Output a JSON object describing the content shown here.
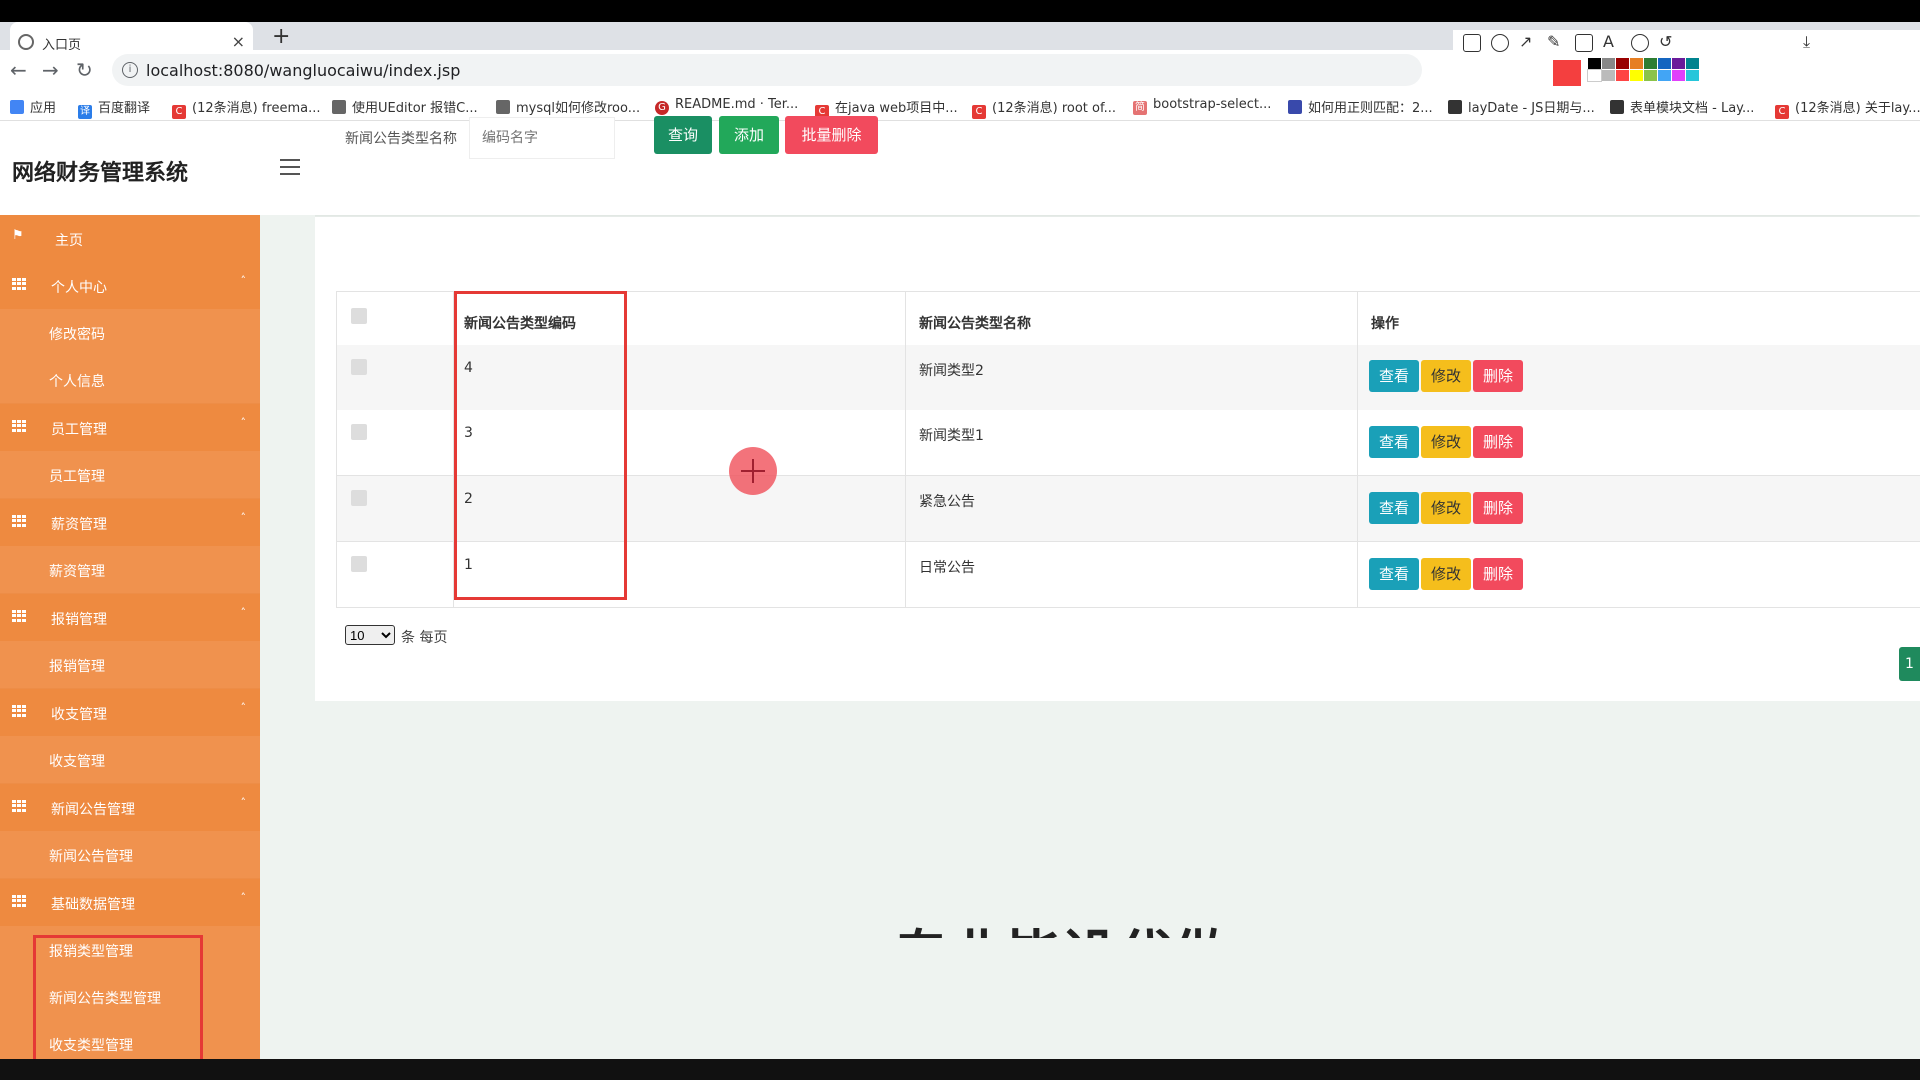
{
  "browser": {
    "tab_title": "入口页",
    "tab_close": "×",
    "new_tab": "+",
    "url": "localhost:8080/wangluocaiwu/index.jsp",
    "bookmarks": [
      "应用",
      "百度翻译",
      "(12条消息) freema...",
      "使用UEditor 报错C...",
      "mysql如何修改roo...",
      "README.md · Ter...",
      "在java web项目中...",
      "(12条消息) root of...",
      "bootstrap-select...",
      "如何用正则匹配：2...",
      "layDate - JS日期与...",
      "表单模块文档 - Lay...",
      "(12条消息) 关于lay..."
    ]
  },
  "app": {
    "brand": "网络财务管理系统",
    "sidebar": [
      {
        "label": "主页",
        "type": "top"
      },
      {
        "label": "个人中心",
        "type": "parent"
      },
      {
        "label": "修改密码",
        "type": "child"
      },
      {
        "label": "个人信息",
        "type": "child"
      },
      {
        "label": "员工管理",
        "type": "parent"
      },
      {
        "label": "员工管理",
        "type": "child"
      },
      {
        "label": "薪资管理",
        "type": "parent"
      },
      {
        "label": "薪资管理",
        "type": "child"
      },
      {
        "label": "报销管理",
        "type": "parent"
      },
      {
        "label": "报销管理",
        "type": "child"
      },
      {
        "label": "收支管理",
        "type": "parent"
      },
      {
        "label": "收支管理",
        "type": "child"
      },
      {
        "label": "新闻公告管理",
        "type": "parent"
      },
      {
        "label": "新闻公告管理",
        "type": "child"
      },
      {
        "label": "基础数据管理",
        "type": "parent"
      },
      {
        "label": "报销类型管理",
        "type": "child"
      },
      {
        "label": "新闻公告类型管理",
        "type": "child"
      },
      {
        "label": "收支类型管理",
        "type": "child"
      }
    ],
    "search": {
      "label": "新闻公告类型名称",
      "placeholder": "编码名字",
      "query_button": "查询",
      "add_button": "添加",
      "batch_delete_button": "批量删除"
    },
    "table": {
      "headers": [
        "新闻公告类型编码",
        "新闻公告类型名称",
        "操作"
      ],
      "rows": [
        {
          "code": "4",
          "name": "新闻类型2"
        },
        {
          "code": "3",
          "name": "新闻类型1"
        },
        {
          "code": "2",
          "name": "紧急公告"
        },
        {
          "code": "1",
          "name": "日常公告"
        }
      ],
      "actions": {
        "view": "查看",
        "edit": "修改",
        "delete": "删除"
      }
    },
    "pager": {
      "page_size": "10",
      "per_page_text": "条 每页",
      "current_page": "1"
    },
    "banner_text": "专业毕设代做"
  },
  "colors": {
    "sidebar": "#ed8d47",
    "query": "#1a8f63",
    "add": "#22a85a",
    "danger": "#f24a5d",
    "view": "#1aa0b8",
    "edit": "#f5be1c",
    "annotation": "#e53935"
  }
}
